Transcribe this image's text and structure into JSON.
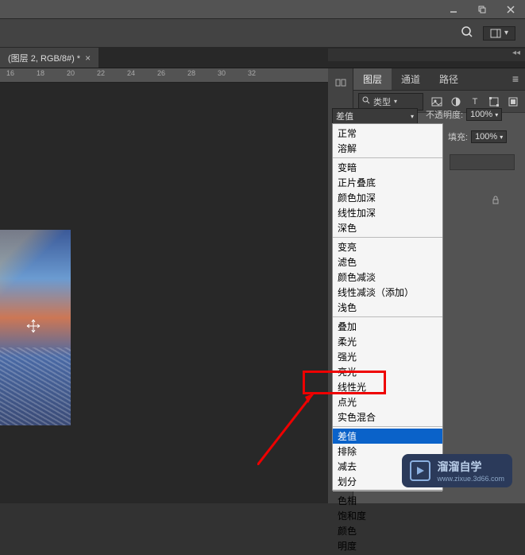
{
  "doc_tab": {
    "title": "(图层 2, RGB/8#) *",
    "close": "×"
  },
  "ruler": {
    "marks": [
      "16",
      "18",
      "20",
      "22",
      "24",
      "26",
      "28",
      "30",
      "32"
    ]
  },
  "panel": {
    "tab_layers": "图层",
    "tab_channels": "通道",
    "tab_paths": "路径",
    "filter_label": "类型",
    "opacity_label": "不透明度:",
    "opacity_value": "100%",
    "fill_label": "填充:",
    "fill_value": "100%"
  },
  "blend": {
    "current": "差值",
    "groups": [
      {
        "items": [
          "正常",
          "溶解"
        ]
      },
      {
        "items": [
          "变暗",
          "正片叠底",
          "颜色加深",
          "线性加深",
          "深色"
        ]
      },
      {
        "items": [
          "变亮",
          "滤色",
          "颜色减淡",
          "线性减淡（添加）",
          "浅色"
        ]
      },
      {
        "items": [
          "叠加",
          "柔光",
          "强光",
          "亮光",
          "线性光",
          "点光",
          "实色混合"
        ]
      },
      {
        "items": [
          "差值",
          "排除",
          "减去",
          "划分"
        ]
      },
      {
        "items": [
          "色相",
          "饱和度",
          "颜色",
          "明度"
        ]
      }
    ],
    "selected": "差值"
  },
  "watermark": {
    "brand": "溜溜自学",
    "url": "www.zixue.3d66.com"
  }
}
